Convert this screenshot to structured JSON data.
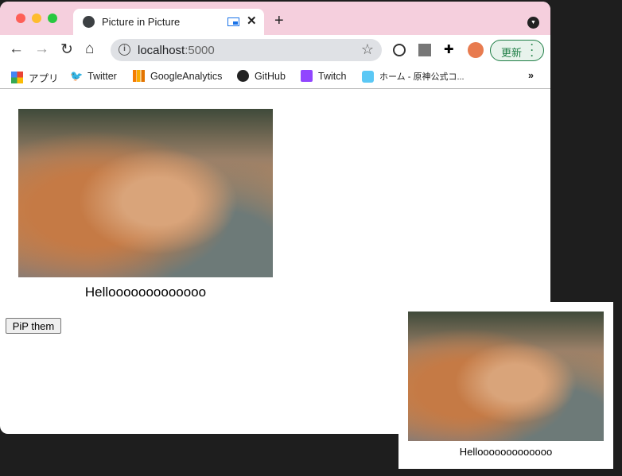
{
  "tab": {
    "title": "Picture in Picture"
  },
  "address": {
    "host": "localhost",
    "port": ":5000"
  },
  "update_label": "更新",
  "bookmarks": [
    {
      "label": "アプリ"
    },
    {
      "label": "Twitter"
    },
    {
      "label": "GoogleAnalytics"
    },
    {
      "label": "GitHub"
    },
    {
      "label": "Twitch"
    },
    {
      "label": "ホーム - 原神公式コ..."
    }
  ],
  "bookmarks_more": "»",
  "page": {
    "caption": "Hellooooooooooooo",
    "button_label": "PiP them"
  },
  "pip": {
    "caption": "Hellooooooooooooo"
  },
  "colors": {
    "tabbar": "#f5cfdd",
    "accent": "#1a73e8",
    "update": "#1e7e45"
  }
}
